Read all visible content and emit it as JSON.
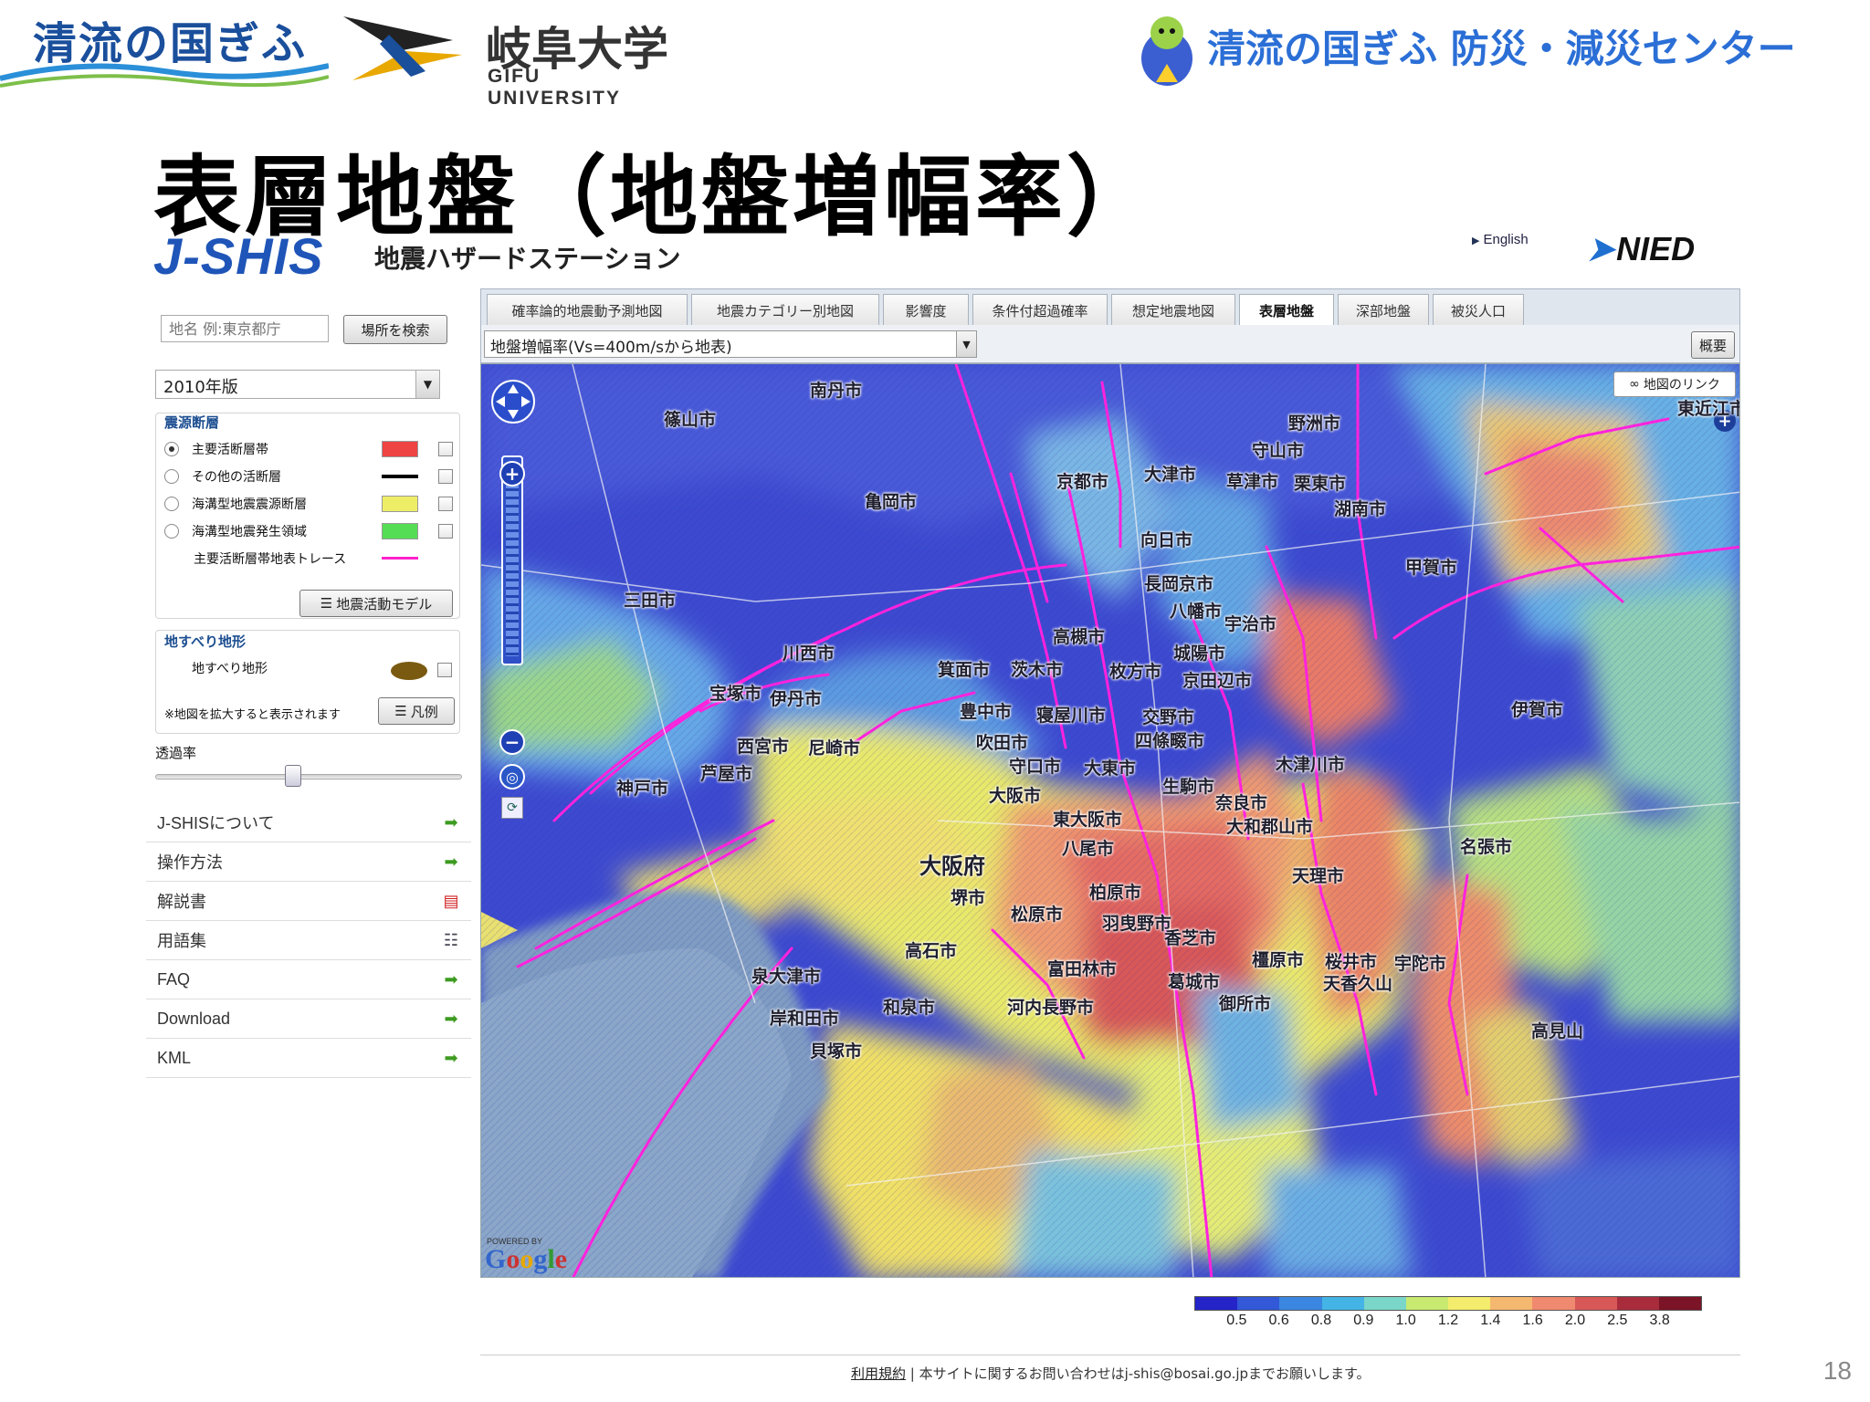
{
  "header": {
    "left_logo_text": "清流の国ぎふ",
    "university_ja": "岐阜大学",
    "university_en": "GIFU UNIVERSITY",
    "center_title": "清流の国ぎふ 防災・減災センター"
  },
  "slide": {
    "title": "表層地盤（地盤増幅率）",
    "number": "18"
  },
  "jshis": {
    "logo": "J-SHIS",
    "subtitle": "地震ハザードステーション",
    "lang_link": "English",
    "nied": "NIED"
  },
  "sidebar": {
    "search_placeholder": "地名 例:東京都庁",
    "search_button": "場所を検索",
    "year_select": "2010年版",
    "quake_panel_title": "震源断層",
    "faults": [
      {
        "label": "主要活断層帯",
        "selected": true,
        "color": "#ee4444"
      },
      {
        "label": "その他の活断層",
        "selected": false,
        "color": "#000000"
      },
      {
        "label": "海溝型地震震源断層",
        "selected": false,
        "color": "#eeee66"
      },
      {
        "label": "海溝型地震発生領域",
        "selected": false,
        "color": "#55dd55"
      }
    ],
    "trace_label": "主要活断層帯地表トレース",
    "trace_color": "#ff22cc",
    "model_button": "地震活動モデル",
    "landslide_title": "地すべり地形",
    "landslide_label": "地すべり地形",
    "landslide_note": "※地図を拡大すると表示されます",
    "legend_button": "凡例",
    "opacity_label": "透過率",
    "opacity_value": 0.45,
    "menu": [
      {
        "label": "J-SHISについて",
        "icon": "arrow-icon"
      },
      {
        "label": "操作方法",
        "icon": "arrow-icon"
      },
      {
        "label": "解説書",
        "icon": "pdf-icon"
      },
      {
        "label": "用語集",
        "icon": "doc-icon"
      },
      {
        "label": "FAQ",
        "icon": "arrow-icon"
      },
      {
        "label": "Download",
        "icon": "arrow-icon"
      },
      {
        "label": "KML",
        "icon": "arrow-icon"
      }
    ]
  },
  "tabs": [
    {
      "label": "確率論的地震動予測地図",
      "active": false
    },
    {
      "label": "地震カテゴリー別地図",
      "active": false
    },
    {
      "label": "影響度",
      "active": false
    },
    {
      "label": "条件付超過確率",
      "active": false
    },
    {
      "label": "想定地震地図",
      "active": false
    },
    {
      "label": "表層地盤",
      "active": true
    },
    {
      "label": "深部地盤",
      "active": false
    },
    {
      "label": "被災人口",
      "active": false
    }
  ],
  "toolbar": {
    "layer_select": "地盤増幅率(Vs=400m/sから地表)",
    "overview_button": "概要"
  },
  "map": {
    "map_link_button": "地図のリンク",
    "powered_by": "POWERED BY",
    "google": "Google",
    "places": [
      "南丹市",
      "亀岡市",
      "京都市",
      "大津市",
      "草津市",
      "栗東市",
      "守山市",
      "野洲市",
      "東近江市",
      "湖南市",
      "甲賀市",
      "篠山市",
      "三田市",
      "向日市",
      "長岡京市",
      "八幡市",
      "宇治市",
      "城陽市",
      "京田辺市",
      "高槻市",
      "茨木市",
      "枚方市",
      "川西市",
      "箕面市",
      "伊丹市",
      "宝塚市",
      "豊中市",
      "寝屋川市",
      "交野市",
      "四條畷市",
      "吹田市",
      "守口市",
      "大東市",
      "尼崎市",
      "西宮市",
      "芦屋市",
      "神戸市",
      "大阪市",
      "東大阪市",
      "八尾市",
      "生駒市",
      "奈良市",
      "大和郡山市",
      "木津川市",
      "大阪府",
      "堺市",
      "松原市",
      "柏原市",
      "羽曳野市",
      "香芝市",
      "天理市",
      "名張市",
      "伊賀市",
      "橿原市",
      "桜井市",
      "宇陀市",
      "高石市",
      "泉大津市",
      "和泉市",
      "富田林市",
      "葛城市",
      "御所市",
      "河内長野市",
      "岸和田市",
      "貝塚市",
      "高見山",
      "天香久山"
    ]
  },
  "color_scale": {
    "colors": [
      "#2424c8",
      "#3358d8",
      "#3a86e0",
      "#44b4e6",
      "#7ad6c8",
      "#c8ea70",
      "#f3ec6c",
      "#f5b870",
      "#ef8a70",
      "#d85858",
      "#a82c3c",
      "#7a1426"
    ],
    "labels": [
      "0.5",
      "0.6",
      "0.8",
      "0.9",
      "1.0",
      "1.2",
      "1.4",
      "1.6",
      "2.0",
      "2.5",
      "3.8"
    ]
  },
  "footer": {
    "terms_link": "利用規約",
    "text": "| 本サイトに関するお問い合わせはj-shis@bosai.go.jpまでお願いします。"
  }
}
